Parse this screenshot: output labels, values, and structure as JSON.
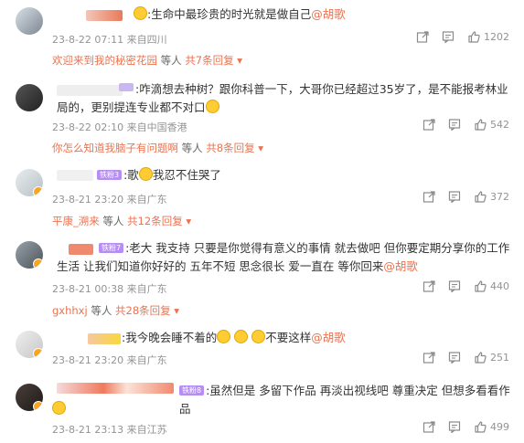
{
  "comments": [
    {
      "text": ":生命中最珍贵的时光就是做自己",
      "mention": "@胡歌",
      "time": "23-8-22 07:11",
      "location": "来自四川",
      "likes": "1202",
      "reply_user": "欢迎来到我的秘密花园",
      "reply_etc": "等人",
      "reply_count": "共7条回复"
    },
    {
      "text": ":咋滴想去种树？跟你科普一下，大哥你已经超过35岁了，是不能报考林业局的，更别提连专业都不对口",
      "time": "23-8-22 02:10",
      "location": "来自中国香港",
      "likes": "542",
      "reply_user": "你怎么知道我脑子有问题啊",
      "reply_etc": "等人",
      "reply_count": "共8条回复"
    },
    {
      "badge": "铁粉3",
      "text": ":歌",
      "text2": "我忍不住哭了",
      "time": "23-8-21 23:20",
      "location": "来自广东",
      "likes": "372",
      "reply_user": "平康_溯来",
      "reply_etc": "等人",
      "reply_count": "共12条回复"
    },
    {
      "badge": "铁粉7",
      "text": ":老大 我支持 只要是你觉得有意义的事情 就去做吧 但你要定期分享你的工作生活 让我们知道你好好的  五年不短 思念很长  爱一直在  等你回来",
      "mention": "@胡歌",
      "time": "23-8-21 00:38",
      "location": "来自广东",
      "likes": "440",
      "reply_user": "gxhhxj",
      "reply_etc": "等人",
      "reply_count": "共28条回复"
    },
    {
      "text": ":我今晚会睡不着的",
      "text2": "不要这样",
      "mention": "@胡歌",
      "time": "23-8-21 23:20",
      "location": "来自广东",
      "likes": "251"
    },
    {
      "badge": "铁粉8",
      "text": ":虽然但是 多留下作品 再淡出视线吧 尊重决定 但想多看看作品",
      "time": "23-8-21 23:13",
      "location": "来自江苏",
      "likes": "499"
    }
  ],
  "icons": {
    "share": "share-icon",
    "comment": "comment-icon",
    "like": "thumbs-up-icon",
    "expand": "triangle-down-icon"
  },
  "colors": {
    "accent": "#eb7350",
    "meta": "#939393",
    "badge": "#b68cf5"
  }
}
